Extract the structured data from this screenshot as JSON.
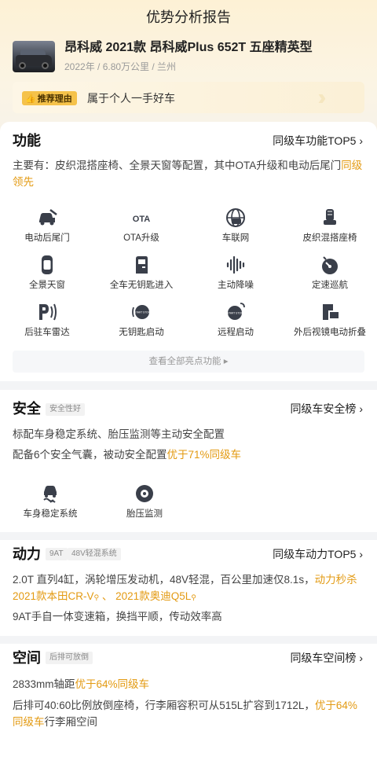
{
  "nav": {
    "title": "优势分析报告"
  },
  "car": {
    "name": "昂科威 2021款 昂科威Plus 652T 五座精英型",
    "meta": "2022年 / 6.80万公里 / 兰州"
  },
  "reason": {
    "tag": "推荐理由",
    "text": "属于个人一手好车"
  },
  "function": {
    "title": "功能",
    "link": "同级车功能TOP5 ›",
    "desc_prefix": "主要有：皮织混搭座椅、全景天窗等配置，其中OTA升级和电动后尾门",
    "desc_highlight": "同级领先",
    "features": [
      {
        "label": "电动后尾门",
        "icon": "tailgate-icon"
      },
      {
        "label": "OTA升级",
        "icon": "ota-icon"
      },
      {
        "label": "车联网",
        "icon": "connected-car-icon"
      },
      {
        "label": "皮织混搭座椅",
        "icon": "seat-icon"
      },
      {
        "label": "全景天窗",
        "icon": "sunroof-icon"
      },
      {
        "label": "全车无钥匙进入",
        "icon": "keyless-entry-icon"
      },
      {
        "label": "主动降噪",
        "icon": "noise-cancel-icon"
      },
      {
        "label": "定速巡航",
        "icon": "cruise-control-icon"
      },
      {
        "label": "后驻车雷达",
        "icon": "parking-radar-icon"
      },
      {
        "label": "无钥匙启动",
        "icon": "keyless-start-icon"
      },
      {
        "label": "远程启动",
        "icon": "remote-start-icon"
      },
      {
        "label": "外后视镜电动折叠",
        "icon": "mirror-fold-icon"
      }
    ],
    "ota_glyph": "OTA",
    "start_glyph": "START STOP",
    "more": "查看全部亮点功能 ▸"
  },
  "safety": {
    "title": "安全",
    "chip": "安全性好",
    "link": "同级车安全榜 ›",
    "line1": "标配车身稳定系统、胎压监测等主动安全配置",
    "line2_prefix": "配备6个安全气囊，被动安全配置",
    "line2_highlight": "优于71%同级车",
    "features": [
      {
        "label": "车身稳定系统",
        "icon": "stability-control-icon"
      },
      {
        "label": "胎压监测",
        "icon": "tire-pressure-icon"
      }
    ]
  },
  "power": {
    "title": "动力",
    "chips": [
      "9AT",
      "48V轻混系统"
    ],
    "link": "同级车动力TOP5 ›",
    "line1_prefix": "2.0T 直列4缸，涡轮增压发动机，48V轻混，百公里加速仅8.1s，",
    "line1_highlight": "动力秒杀",
    "compare_a": "2021款本田CR-V",
    "sep": "、",
    "compare_b": "2021款奥迪Q5L",
    "line2": "9AT手自一体变速箱，换挡平顺，传动效率高"
  },
  "space": {
    "title": "空间",
    "chip": "后排可放倒",
    "link": "同级车空间榜 ›",
    "line1_prefix": "2833mm轴距",
    "line1_highlight": "优于64%同级车",
    "line2_prefix": "后排可40:60比例放倒座椅，行李厢容积可从515L扩容到1712L，",
    "line2_highlight": "优于64%同级车",
    "line2_suffix": "行李厢空间"
  },
  "colors": {
    "accent": "#e39a12",
    "tag": "#f5c24a",
    "icon": "#3a3f4a"
  }
}
